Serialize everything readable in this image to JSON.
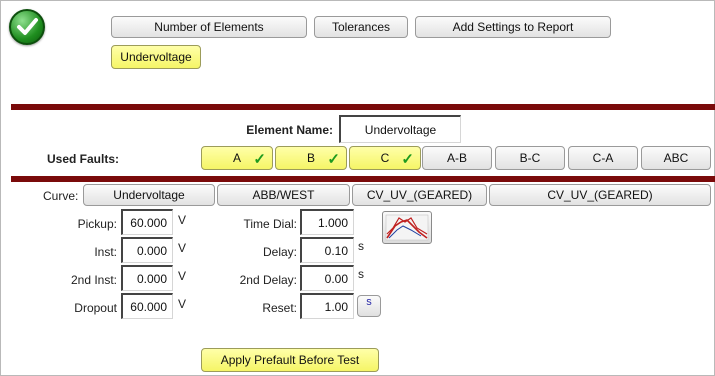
{
  "header": {
    "buttons": {
      "number_of_elements": "Number of Elements",
      "tolerances": "Tolerances",
      "add_settings": "Add Settings to Report",
      "element_tab": "Undervoltage"
    }
  },
  "element": {
    "name_label": "Element Name:",
    "name_value": "Undervoltage"
  },
  "faults": {
    "label": "Used Faults:",
    "items": [
      {
        "label": "A",
        "selected": true
      },
      {
        "label": "B",
        "selected": true
      },
      {
        "label": "C",
        "selected": true
      },
      {
        "label": "A-B",
        "selected": false
      },
      {
        "label": "B-C",
        "selected": false
      },
      {
        "label": "C-A",
        "selected": false
      },
      {
        "label": "ABC",
        "selected": false
      }
    ],
    "check_glyph": "✓"
  },
  "curve": {
    "label": "Curve:",
    "type": "Undervoltage",
    "manufacturer": "ABB/WEST",
    "model": "CV_UV_(GEARED)",
    "curve_name": "CV_UV_(GEARED)"
  },
  "settings": {
    "pickup": {
      "label": "Pickup:",
      "value": "60.000",
      "unit": "V"
    },
    "inst": {
      "label": "Inst:",
      "value": "0.000",
      "unit": "V"
    },
    "second_inst": {
      "label": "2nd Inst:",
      "value": "0.000",
      "unit": "V"
    },
    "dropout": {
      "label": "Dropout",
      "value": "60.000",
      "unit": "V"
    },
    "time_dial": {
      "label": "Time Dial:",
      "value": "1.000"
    },
    "delay": {
      "label": "Delay:",
      "value": "0.10",
      "unit": "s"
    },
    "second_delay": {
      "label": "2nd Delay:",
      "value": "0.00",
      "unit": "s"
    },
    "reset": {
      "label": "Reset:",
      "value": "1.00",
      "unit_button": "s"
    }
  },
  "footer": {
    "apply_prefault": "Apply Prefault Before Test"
  },
  "colors": {
    "accent_bar": "#7a0a0a",
    "selected_button": "#ffff8c",
    "check_green": "#1e9a1e"
  },
  "icons": {
    "status": "green-check-circle-icon",
    "curve": "curve-graph-icon"
  }
}
